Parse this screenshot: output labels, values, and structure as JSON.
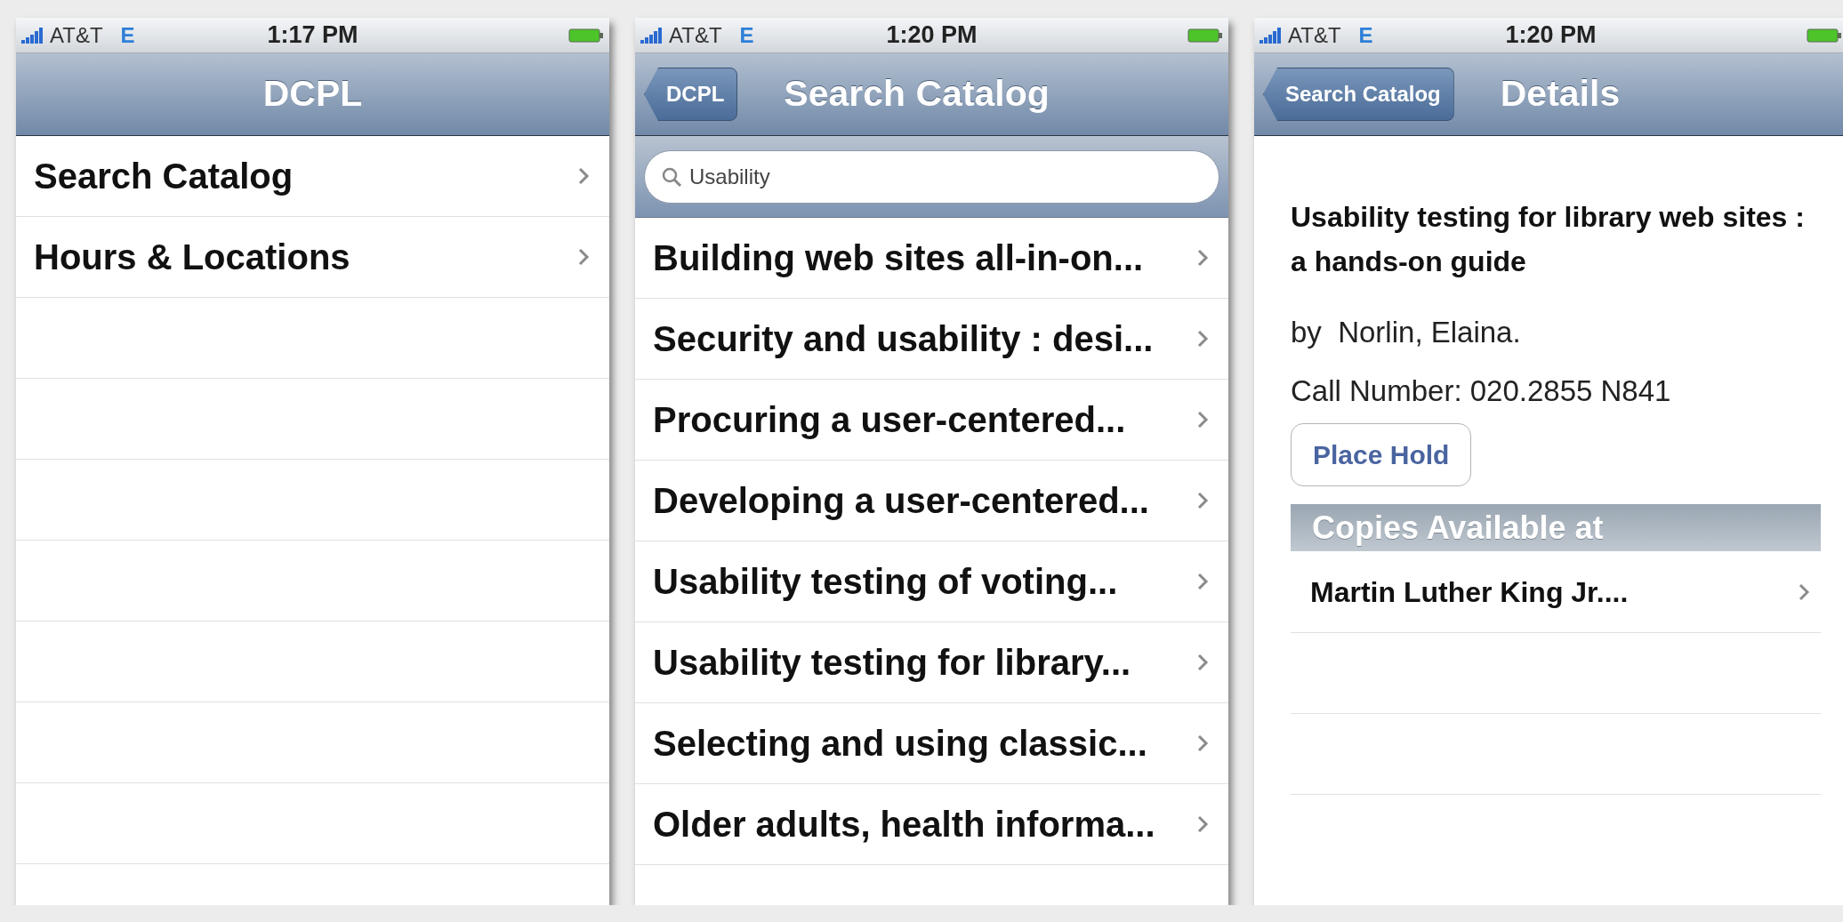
{
  "screens": [
    {
      "kind": "menu",
      "status": {
        "carrier": "AT&T",
        "network": "E",
        "time": "1:17 PM"
      },
      "nav": {
        "title": "DCPL"
      },
      "rows": [
        {
          "label": "Search Catalog"
        },
        {
          "label": "Hours & Locations"
        }
      ]
    },
    {
      "kind": "results",
      "status": {
        "carrier": "AT&T",
        "network": "E",
        "time": "1:20 PM"
      },
      "nav": {
        "back": "DCPL",
        "title": "Search Catalog"
      },
      "search": {
        "value": "Usability"
      },
      "rows": [
        {
          "label": "Building web sites all-in-on..."
        },
        {
          "label": "Security and usability : desi..."
        },
        {
          "label": "Procuring a user-centered..."
        },
        {
          "label": "Developing a user-centered..."
        },
        {
          "label": "Usability testing of voting..."
        },
        {
          "label": "Usability testing for library..."
        },
        {
          "label": "Selecting and using classic..."
        },
        {
          "label": "Older adults, health informa..."
        }
      ]
    },
    {
      "kind": "details",
      "status": {
        "carrier": "AT&T",
        "network": "E",
        "time": "1:20 PM"
      },
      "nav": {
        "back": "Search Catalog",
        "title": "Details"
      },
      "title": "Usability testing for library web sites : a hands-on guide",
      "author": "by  Norlin, Elaina.",
      "call_number": "Call Number: 020.2855 N841",
      "button": "Place Hold",
      "section": "Copies Available at",
      "rows": [
        {
          "label": "Martin Luther King Jr...."
        }
      ]
    }
  ]
}
